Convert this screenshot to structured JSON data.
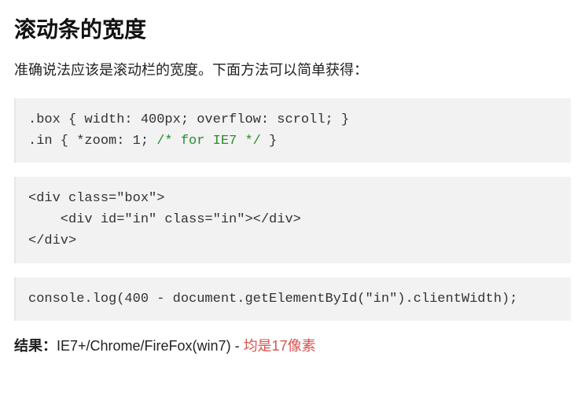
{
  "heading": "滚动条的宽度",
  "intro": "准确说法应该是滚动栏的宽度。下面方法可以简单获得：",
  "code1_line1": ".box { width: 400px; overflow: scroll; }",
  "code1_line2_pre": ".in { *zoom: 1; ",
  "code1_line2_comment": "/* for IE7 */",
  "code1_line2_post": " }",
  "code2": "<div class=\"box\">\n    <div id=\"in\" class=\"in\"></div>\n</div>",
  "code3": "console.log(400 - document.getElementById(\"in\").clientWidth);",
  "result_label": "结果：",
  "result_text": "IE7+/Chrome/FireFox(win7) - ",
  "result_highlight": "均是17像素"
}
